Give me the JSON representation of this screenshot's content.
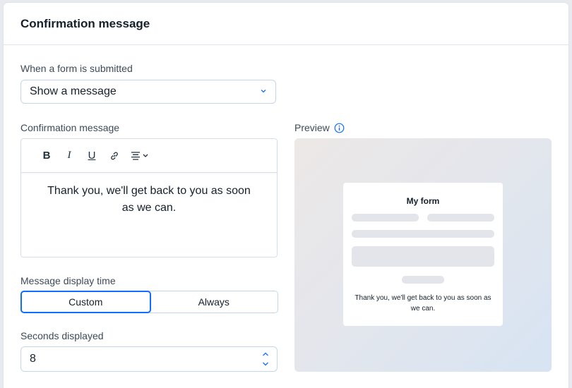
{
  "header": {
    "title": "Confirmation message"
  },
  "submit": {
    "label": "When a form is submitted",
    "selected": "Show a message"
  },
  "editor": {
    "label": "Confirmation message",
    "toolbar": {
      "bold": "B",
      "italic": "I",
      "underline": "U"
    },
    "text": "Thank you, we'll get back to you as soon as we can."
  },
  "display_time": {
    "label": "Message display time",
    "options": [
      "Custom",
      "Always"
    ],
    "selected": "Custom"
  },
  "seconds": {
    "label": "Seconds displayed",
    "value": "8"
  },
  "preview": {
    "label": "Preview",
    "form_title": "My form",
    "message": "Thank you, we'll get back to you as soon as we can."
  },
  "colors": {
    "accent": "#116dff",
    "border": "#c5d6ea"
  },
  "icons": [
    "chevron-down-icon",
    "bold-icon",
    "italic-icon",
    "underline-icon",
    "link-icon",
    "align-center-icon",
    "info-icon",
    "stepper-icon"
  ]
}
